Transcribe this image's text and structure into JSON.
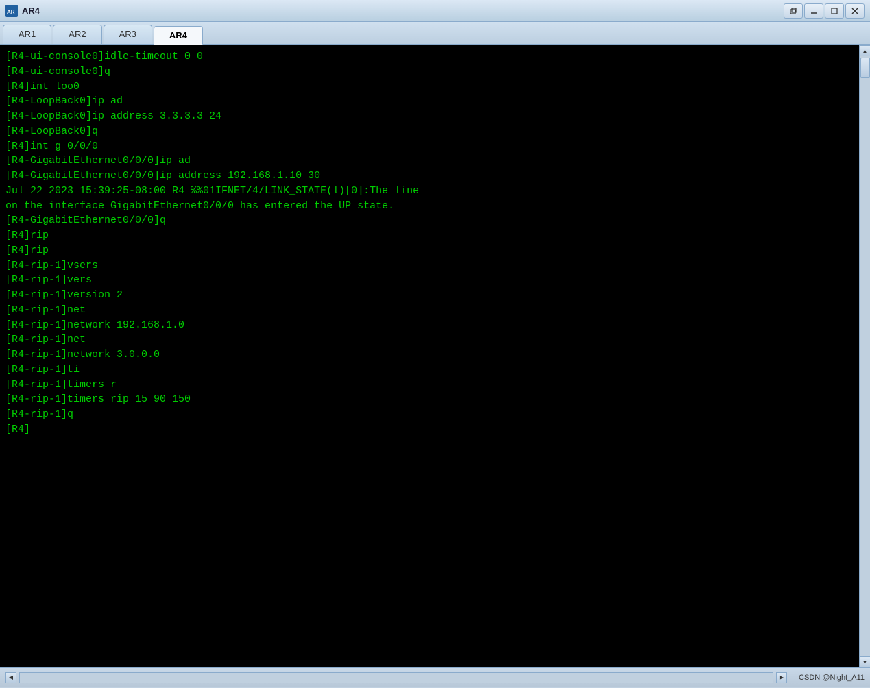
{
  "titleBar": {
    "icon": "AR",
    "title": "AR4",
    "minimizeLabel": "─",
    "maximizeLabel": "□",
    "closeLabel": "✕"
  },
  "tabs": [
    {
      "id": "AR1",
      "label": "AR1",
      "active": false
    },
    {
      "id": "AR2",
      "label": "AR2",
      "active": false
    },
    {
      "id": "AR3",
      "label": "AR3",
      "active": false
    },
    {
      "id": "AR4",
      "label": "AR4",
      "active": true
    }
  ],
  "terminal": {
    "lines": [
      "[R4-ui-console0]idle-timeout 0 0",
      "[R4-ui-console0]q",
      "[R4]int loo0",
      "[R4-LoopBack0]ip ad",
      "[R4-LoopBack0]ip address 3.3.3.3 24",
      "[R4-LoopBack0]q",
      "[R4]int g 0/0/0",
      "[R4-GigabitEthernet0/0/0]ip ad",
      "[R4-GigabitEthernet0/0/0]ip address 192.168.1.10 30",
      "Jul 22 2023 15:39:25-08:00 R4 %%01IFNET/4/LINK_STATE(l)[0]:The line",
      "on the interface GigabitEthernet0/0/0 has entered the UP state.",
      "[R4-GigabitEthernet0/0/0]q",
      "[R4]rip",
      "[R4]rip",
      "[R4-rip-1]vsers",
      "[R4-rip-1]vers",
      "[R4-rip-1]version 2",
      "[R4-rip-1]net",
      "[R4-rip-1]network 192.168.1.0",
      "[R4-rip-1]net",
      "[R4-rip-1]network 3.0.0.0",
      "[R4-rip-1]ti",
      "[R4-rip-1]timers r",
      "[R4-rip-1]timers rip 15 90 150",
      "[R4-rip-1]q",
      "[R4]"
    ]
  },
  "statusBar": {
    "watermark": "CSDN @Night_A11"
  }
}
